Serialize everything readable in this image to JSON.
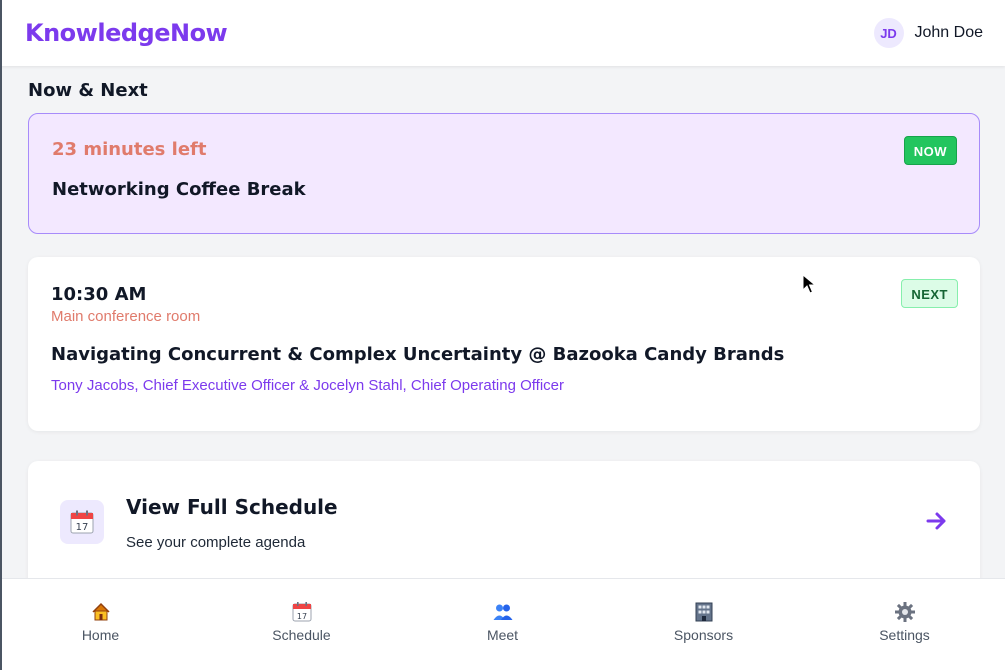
{
  "header": {
    "brand": "KnowledgeNow",
    "user": {
      "initials": "JD",
      "name": "John Doe"
    }
  },
  "main": {
    "section_title": "Now & Next",
    "now": {
      "time_left": "23 minutes left",
      "title": "Networking Coffee Break",
      "badge": "NOW"
    },
    "next": {
      "time": "10:30 AM",
      "room": "Main conference room",
      "title": "Navigating Concurrent & Complex Uncertainty @ Bazooka Candy Brands",
      "speakers": "Tony Jacobs, Chief Executive Officer & Jocelyn Stahl, Chief Operating Officer",
      "badge": "NEXT"
    },
    "schedule_card": {
      "icon": "calendar-icon",
      "icon_date": "17",
      "title": "View Full Schedule",
      "subtitle": "See your complete agenda",
      "arrow_icon": "arrow-right-icon"
    }
  },
  "bottom_nav": {
    "items": [
      {
        "label": "Home",
        "icon": "house-icon"
      },
      {
        "label": "Schedule",
        "icon": "calendar-icon"
      },
      {
        "label": "Meet",
        "icon": "people-icon"
      },
      {
        "label": "Sponsors",
        "icon": "office-building-icon"
      },
      {
        "label": "Settings",
        "icon": "gear-icon"
      }
    ]
  },
  "colors": {
    "brand": "#7c3aed",
    "now_badge": "#22c55e",
    "next_badge_bg": "#dcfce7",
    "accent_red": "#e07b6c",
    "now_card_bg": "#f3e8ff"
  }
}
